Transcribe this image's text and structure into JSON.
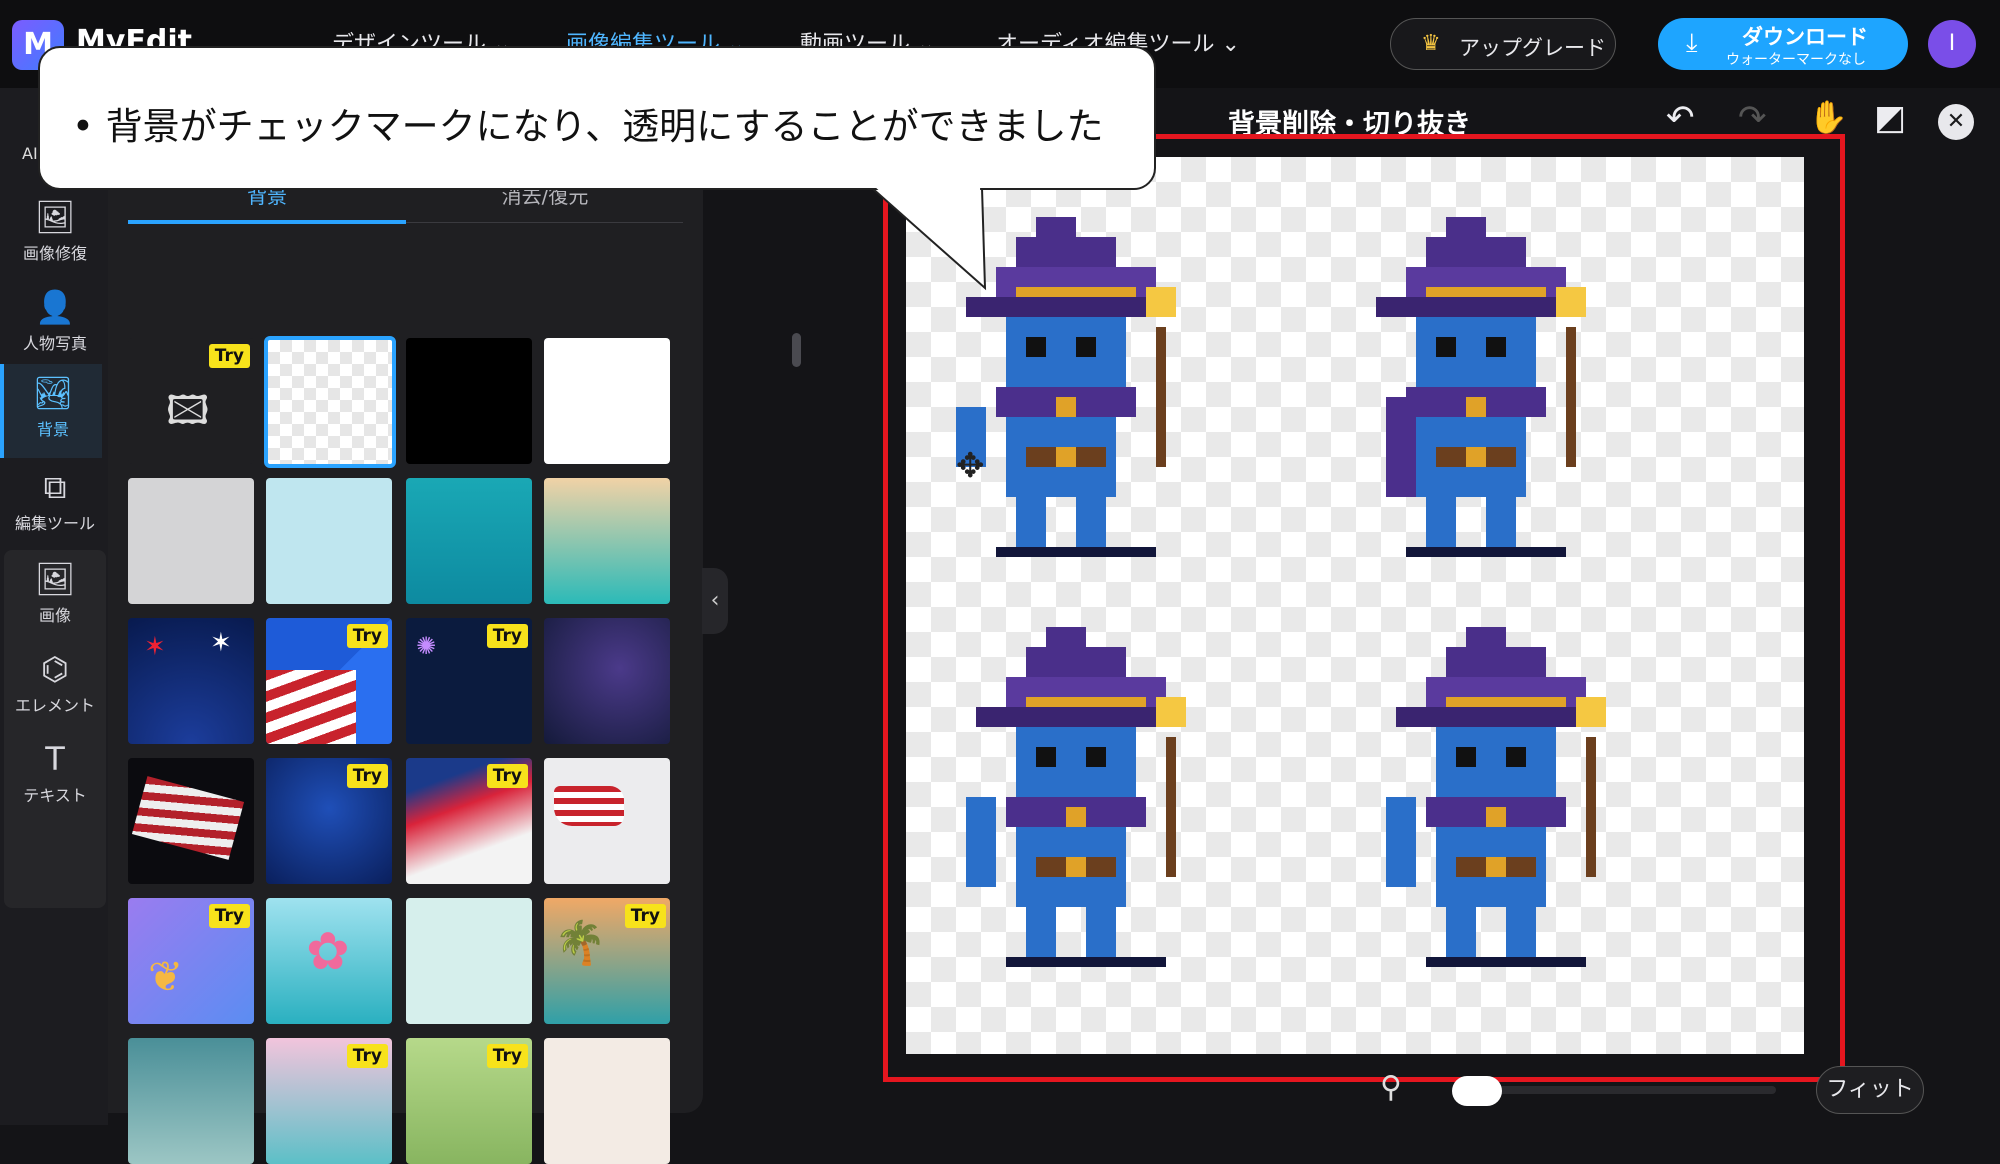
{
  "app": {
    "name": "MyEdit",
    "logo_letter": "M"
  },
  "nav": [
    {
      "label": "デザインツール ⌄"
    },
    {
      "label": "画像編集ツール ⌄"
    },
    {
      "label": "動画ツール ⌄"
    },
    {
      "label": "オーディオ編集ツール ⌄"
    }
  ],
  "header": {
    "upgrade_label": "アップグレード",
    "download_label": "ダウンロード",
    "download_sub": "ウォーターマークなし",
    "avatar_letter": "I"
  },
  "sidebar": {
    "ai_label": "AI",
    "items": [
      {
        "label": "画像修復",
        "icon": "image-repair-icon",
        "glyph": "🖼"
      },
      {
        "label": "人物写真",
        "icon": "portrait-icon",
        "glyph": "👤"
      },
      {
        "label": "背景",
        "icon": "background-icon",
        "glyph": "🏞"
      },
      {
        "label": "編集ツール",
        "icon": "edit-tools-icon",
        "glyph": "⧉"
      },
      {
        "label": "画像",
        "icon": "image-icon",
        "glyph": "🖼"
      },
      {
        "label": "エレメント",
        "icon": "elements-icon",
        "glyph": "⌬"
      },
      {
        "label": "テキスト",
        "icon": "text-icon",
        "glyph": "T"
      }
    ]
  },
  "panel": {
    "tabs": [
      {
        "label": "背景"
      },
      {
        "label": "消去/復元"
      }
    ],
    "try_label": "Try"
  },
  "canvas": {
    "title": "背景削除・切り抜き",
    "fit_label": "フィット"
  },
  "callout": {
    "text": "• 背景がチェックマークになり、透明にすることができました"
  },
  "colors": {
    "accent": "#2aa3ff",
    "highlight_box": "#e5161f",
    "try_badge": "#f7e21b"
  }
}
